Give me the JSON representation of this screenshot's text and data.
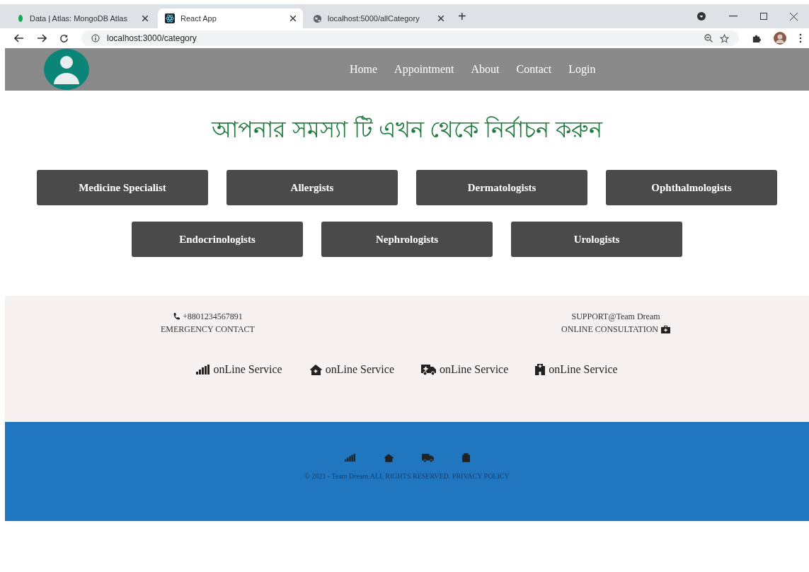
{
  "browser": {
    "tabs": [
      {
        "title": "Data | Atlas: MongoDB Atlas",
        "selected": false
      },
      {
        "title": "React App",
        "selected": true
      },
      {
        "title": "localhost:5000/allCategory",
        "selected": false
      }
    ],
    "new_tab": "+",
    "address": "localhost:3000/category"
  },
  "nav": {
    "links": [
      "Home",
      "Appointment",
      "About",
      "Contact",
      "Login"
    ]
  },
  "heading": "আপনার সমস্যা টি এখন থেকে নির্বাচন করুন",
  "categories": [
    "Medicine Specialist",
    "Allergists",
    "Dermatologists",
    "Ophthalmologists",
    "Endocrinologists",
    "Nephrologists",
    "Urologists"
  ],
  "contact": {
    "phone": "+8801234567891",
    "phone_label": "EMERGENCY CONTACT",
    "support": "SUPPORT@Team Dream",
    "support_label": "ONLINE CONSULTATION"
  },
  "services": [
    "onLine Service",
    "onLine Service",
    "onLine Service",
    "onLine Service"
  ],
  "copyright": "© 2021 - Team Dream.ALL RIGHTS RESERVED. PRIVACY POLICY"
}
